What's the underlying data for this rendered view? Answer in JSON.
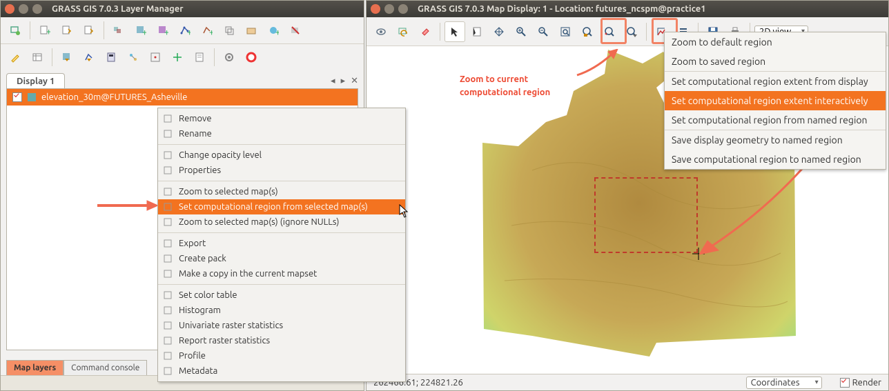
{
  "layerManager": {
    "title": "GRASS GIS 7.0.3 Layer Manager",
    "displayTab": "Display 1",
    "layerName": "elevation_30m@FUTURES_Asheville",
    "bottomTabs": {
      "active": "Map layers",
      "other": "Command console"
    }
  },
  "contextMenu": {
    "items": [
      {
        "label": "Remove"
      },
      {
        "label": "Rename"
      },
      {
        "sep": true
      },
      {
        "label": "Change opacity level"
      },
      {
        "label": "Properties"
      },
      {
        "sep": true
      },
      {
        "label": "Zoom to selected map(s)"
      },
      {
        "label": "Set computational region from selected map(s)",
        "hl": true
      },
      {
        "label": "Zoom to selected map(s) (ignore NULLs)"
      },
      {
        "sep": true
      },
      {
        "label": "Export"
      },
      {
        "label": "Create pack"
      },
      {
        "label": "Make a copy in the current mapset"
      },
      {
        "sep": true
      },
      {
        "label": "Set color table"
      },
      {
        "label": "Histogram"
      },
      {
        "label": "Univariate raster statistics"
      },
      {
        "label": "Report raster statistics"
      },
      {
        "label": "Profile"
      },
      {
        "label": "Metadata"
      }
    ]
  },
  "mapDisplay": {
    "title": "GRASS GIS 7.0.3 Map Display: 1  - Location: futures_ncspm@practice1",
    "viewMode": "2D view",
    "coords": "262466.61; 224821.26",
    "coordLabel": "Coordinates",
    "renderLabel": "Render"
  },
  "dropdown": {
    "items": [
      {
        "label": "Zoom to default region"
      },
      {
        "label": "Zoom to saved region"
      },
      {
        "sep": true
      },
      {
        "label": "Set computational region extent from display"
      },
      {
        "label": "Set computational region extent interactively",
        "hl": true
      },
      {
        "label": "Set computational region from named region"
      },
      {
        "sep": true
      },
      {
        "label": "Save display geometry to named region"
      },
      {
        "label": "Save computational region to named region"
      }
    ]
  },
  "annotation": {
    "line1": "Zoom to current",
    "line2": "computational region"
  }
}
